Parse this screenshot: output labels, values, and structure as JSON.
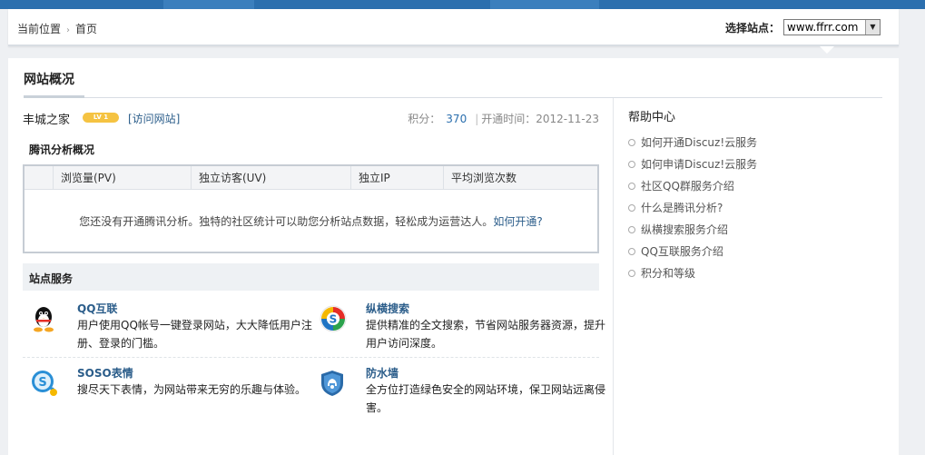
{
  "breadcrumb": {
    "items": [
      "当前位置",
      "首页"
    ],
    "separator": "›"
  },
  "site_select": {
    "label": "选择站点：",
    "value": "www.ffrr.com"
  },
  "main": {
    "title": "网站概况",
    "site": {
      "name": "丰城之家",
      "level_badge": "LV 1",
      "visit_link": "[访问网站]",
      "score_label": "积分：",
      "score_value": "370",
      "open_time": "开通时间：2012-11-23"
    },
    "tencent_analysis": {
      "title": "腾讯分析概况",
      "columns": [
        "",
        "浏览量(PV)",
        "独立访客(UV)",
        "独立IP",
        "平均浏览次数"
      ],
      "empty_message": "您还没有开通腾讯分析。独特的社区统计可以助您分析站点数据，轻松成为运营达人。",
      "empty_link": "如何开通?"
    },
    "services": {
      "title": "站点服务",
      "items": [
        {
          "name": "QQ互联",
          "desc": "用户使用QQ帐号一键登录网站，大大降低用户注册、登录的门槛。",
          "icon": "qq-penguin-icon"
        },
        {
          "name": "纵横搜索",
          "desc": "提供精准的全文搜索，节省网站服务器资源，提升用户访问深度。",
          "icon": "soso-search-icon"
        },
        {
          "name": "SOSO表情",
          "desc": "搜尽天下表情，为网站带来无穷的乐趣与体验。",
          "icon": "soso-emoticon-icon"
        },
        {
          "name": "防水墙",
          "desc": "全方位打造绿色安全的网站环境，保卫网站远离侵害。",
          "icon": "shield-icon"
        }
      ]
    }
  },
  "help_center": {
    "title": "帮助中心",
    "items": [
      "如何开通Discuz!云服务",
      "如何申请Discuz!云服务",
      "社区QQ群服务介绍",
      "什么是腾讯分析?",
      "纵横搜索服务介绍",
      "QQ互联服务介绍",
      "积分和等级"
    ]
  },
  "colors": {
    "top_bar": "#2b6fae",
    "link": "#2b5d8a",
    "score": "#2b6fae",
    "badge": "#f5c342"
  }
}
